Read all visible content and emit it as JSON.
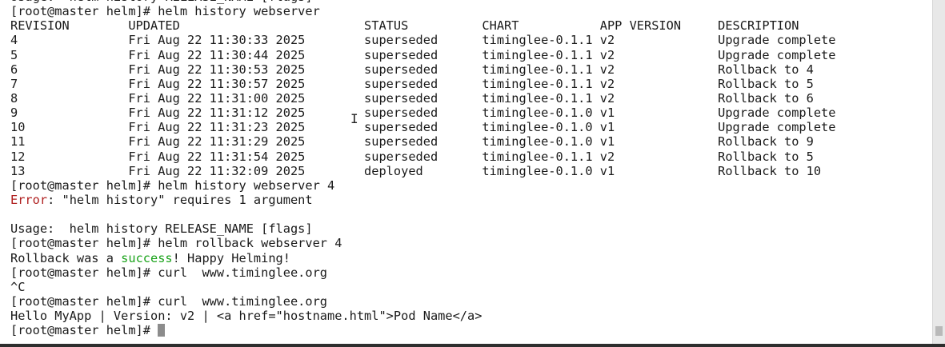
{
  "terminal": {
    "lines": [
      [
        {
          "text": "Usage:  helm history RELEASE_NAME [flags]"
        }
      ],
      [
        {
          "text": "[root@master helm]# helm history webserver"
        }
      ],
      [
        {
          "text": "REVISION        UPDATED                         STATUS          CHART           APP VERSION     DESCRIPTION"
        }
      ],
      [
        {
          "text": "4               Fri Aug 22 11:30:33 2025        superseded      timinglee-0.1.1 v2              Upgrade complete"
        }
      ],
      [
        {
          "text": "5               Fri Aug 22 11:30:44 2025        superseded      timinglee-0.1.1 v2              Upgrade complete"
        }
      ],
      [
        {
          "text": "6               Fri Aug 22 11:30:53 2025        superseded      timinglee-0.1.1 v2              Rollback to 4"
        }
      ],
      [
        {
          "text": "7               Fri Aug 22 11:30:57 2025        superseded      timinglee-0.1.1 v2              Rollback to 5"
        }
      ],
      [
        {
          "text": "8               Fri Aug 22 11:31:00 2025        superseded      timinglee-0.1.1 v2              Rollback to 6"
        }
      ],
      [
        {
          "text": "9               Fri Aug 22 11:31:12 2025        superseded      timinglee-0.1.0 v1              Upgrade complete"
        }
      ],
      [
        {
          "text": "10              Fri Aug 22 11:31:23 2025        superseded      timinglee-0.1.0 v1              Upgrade complete"
        }
      ],
      [
        {
          "text": "11              Fri Aug 22 11:31:29 2025        superseded      timinglee-0.1.0 v1              Rollback to 9"
        }
      ],
      [
        {
          "text": "12              Fri Aug 22 11:31:54 2025        superseded      timinglee-0.1.1 v2              Rollback to 5"
        }
      ],
      [
        {
          "text": "13              Fri Aug 22 11:32:09 2025        deployed        timinglee-0.1.0 v1              Rollback to 10"
        }
      ],
      [
        {
          "text": "[root@master helm]# helm history webserver 4"
        }
      ],
      [
        {
          "text": "Error",
          "style": "error"
        },
        {
          "text": ": \"helm history\" requires 1 argument"
        }
      ],
      [
        {
          "text": ""
        }
      ],
      [
        {
          "text": "Usage:  helm history RELEASE_NAME [flags]"
        }
      ],
      [
        {
          "text": "[root@master helm]# helm rollback webserver 4"
        }
      ],
      [
        {
          "text": "Rollback was a "
        },
        {
          "text": "success",
          "style": "success"
        },
        {
          "text": "! Happy Helming!"
        }
      ],
      [
        {
          "text": "[root@master helm]# curl  www.timinglee.org"
        }
      ],
      [
        {
          "text": "^C"
        }
      ],
      [
        {
          "text": "[root@master helm]# curl  www.timinglee.org"
        }
      ],
      [
        {
          "text": "Hello MyApp | Version: v2 | <a href=\"hostname.html\">Pod Name</a>"
        }
      ],
      [
        {
          "text": "[root@master helm]# "
        }
      ]
    ]
  },
  "colors": {
    "background": "#ffffff",
    "text": "#1a1a1a",
    "error": "#b02020",
    "success": "#1aa31a",
    "cursor": "#8c8c8c"
  },
  "icons": {
    "text_cursor": "i-beam-cursor-icon",
    "scrollbar": "vertical-scrollbar"
  }
}
